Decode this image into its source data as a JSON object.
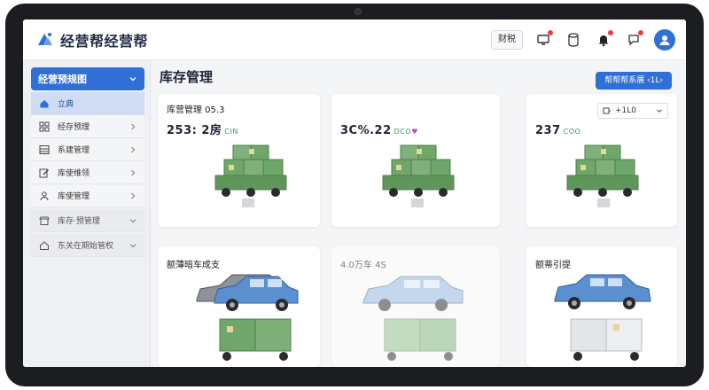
{
  "app": {
    "logo_text": "经营帮经营帮"
  },
  "header": {
    "button_label": "财税",
    "icons": [
      "monitor-icon",
      "cylinder-icon",
      "bell-icon",
      "chat-icon",
      "user-avatar-icon"
    ]
  },
  "sidebar": {
    "head_label": "经营预规图",
    "items": [
      {
        "label": "立典",
        "icon": "home-icon"
      },
      {
        "label": "经存预理",
        "icon": "grid-icon"
      },
      {
        "label": "系建管理",
        "icon": "list-icon"
      },
      {
        "label": "库使维领",
        "icon": "edit-icon"
      },
      {
        "label": "库使管理",
        "icon": "user-icon"
      },
      {
        "label": "库存·预管理",
        "icon": "shop-icon"
      },
      {
        "label": "东关在期始管权",
        "icon": "house-icon"
      }
    ]
  },
  "main": {
    "title": "库存管理",
    "action_button": "帮帮帮系展 ‹1L›",
    "cards": [
      {
        "title": "库营管理 05.3",
        "metric": "253: 2房",
        "suffix": "CIN"
      },
      {
        "title": "",
        "metric": "3C%.22",
        "suffix": "DCO",
        "suffix2": "♥"
      },
      {
        "title": "",
        "metric": "237",
        "suffix": "COO",
        "dropdown": "+1L0"
      },
      {
        "title": "额薄暗车成支",
        "metric": ""
      },
      {
        "title": "4.0万车 4S",
        "metric": ""
      },
      {
        "title": "额蒂引提",
        "metric": ""
      }
    ]
  },
  "colors": {
    "primary": "#2f6fd6",
    "box_green": "#6fa66a",
    "car_blue": "#5b8fcf",
    "car_gray": "#8e939b",
    "badge_red": "#e0453a"
  }
}
